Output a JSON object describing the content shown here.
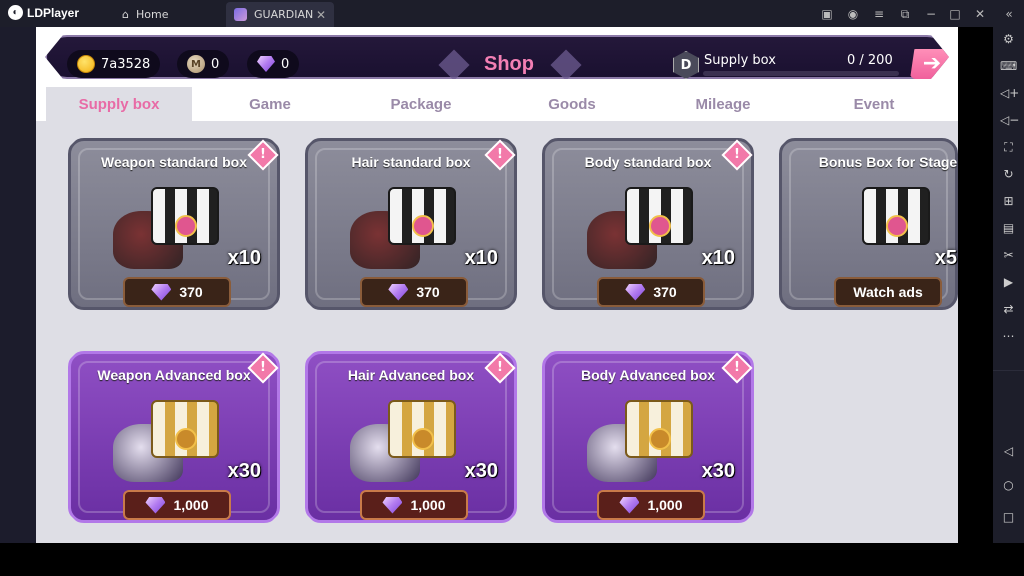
{
  "emulator": {
    "app_name": "LDPlayer",
    "tabs": [
      {
        "label": "Home"
      },
      {
        "label": "GUARDIAN"
      }
    ]
  },
  "shop": {
    "title": "Shop",
    "currencies": {
      "gold": "7a3528",
      "mileage": "0",
      "gems": "0"
    },
    "supply": {
      "label": "Supply box",
      "count": "0 / 200",
      "progress": 0
    }
  },
  "tabs": [
    {
      "label": "Supply box",
      "active": true
    },
    {
      "label": "Game"
    },
    {
      "label": "Package"
    },
    {
      "label": "Goods"
    },
    {
      "label": "Mileage"
    },
    {
      "label": "Event"
    }
  ],
  "cards": [
    {
      "title": "Weapon standard box",
      "qty": "x10",
      "price": "370",
      "tier": "standard"
    },
    {
      "title": "Hair standard box",
      "qty": "x10",
      "price": "370",
      "tier": "standard"
    },
    {
      "title": "Body standard box",
      "qty": "x10",
      "price": "370",
      "tier": "standard"
    },
    {
      "title": "Bonus Box for Stage",
      "qty": "x5",
      "price": "Watch ads",
      "tier": "standard"
    },
    {
      "title": "Weapon Advanced box",
      "qty": "x30",
      "price": "1,000",
      "tier": "advanced"
    },
    {
      "title": "Hair Advanced box",
      "qty": "x30",
      "price": "1,000",
      "tier": "advanced"
    },
    {
      "title": "Body Advanced box",
      "qty": "x30",
      "price": "1,000",
      "tier": "advanced"
    }
  ],
  "colors": {
    "accent_pink": "#f37fb4",
    "advanced_purple": "#7a3cb5",
    "standard_gray": "#7d7d8c"
  }
}
